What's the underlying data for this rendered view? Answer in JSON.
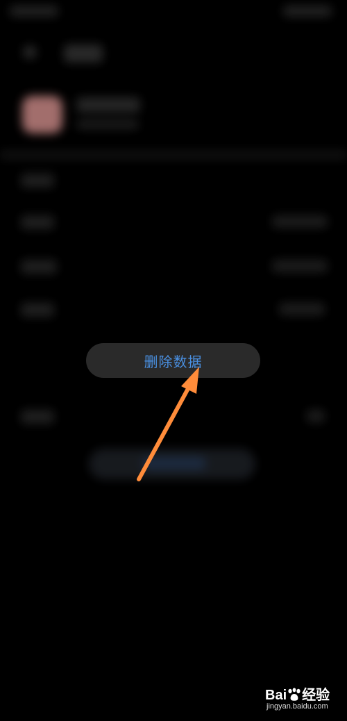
{
  "popup": {
    "label": "删除数据"
  },
  "watermark": {
    "brand_prefix": "Bai",
    "brand_suffix": "经验",
    "site": "jingyan.baidu.com"
  },
  "colors": {
    "popup_text": "#4a90e2",
    "popup_bg": "#2a2a2a",
    "arrow": "#ff8c3a",
    "background": "#000000"
  },
  "icons": {
    "arrow": "pointer-arrow-icon",
    "paw": "baidu-paw-icon"
  }
}
